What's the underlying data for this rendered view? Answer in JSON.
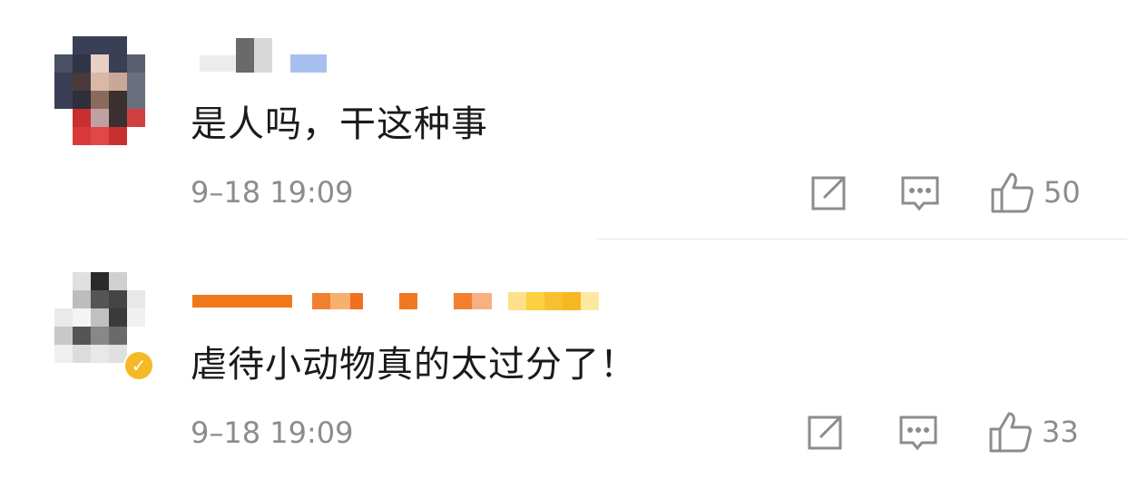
{
  "comments": [
    {
      "text": "是人吗，干这种事",
      "time": "9–18 19:09",
      "likes": "50",
      "verified": false
    },
    {
      "text": "虐待小动物真的太过分了！",
      "time": "9–18 19:09",
      "likes": "33",
      "verified": true
    }
  ],
  "icons": {
    "share": "share-icon",
    "reply": "comment-icon",
    "like": "thumbs-up-icon"
  },
  "colors": {
    "text": "#1a1a1a",
    "meta": "#8c8c8c",
    "verified_badge": "#f5b928"
  }
}
